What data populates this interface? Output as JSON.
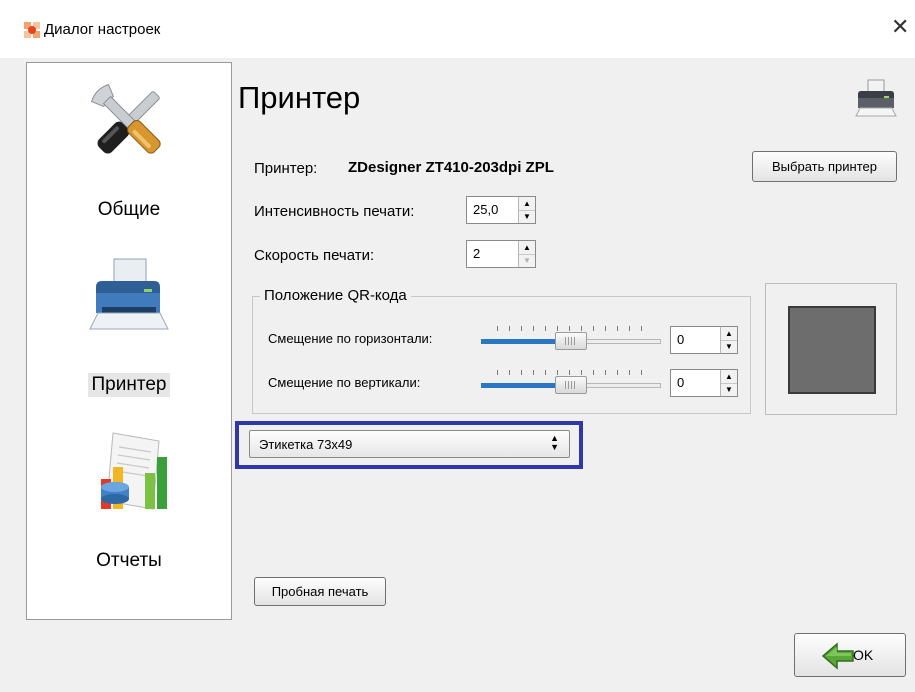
{
  "window": {
    "title": "Диалог настроек",
    "close_glyph": "✕"
  },
  "sidebar": {
    "items": [
      {
        "label": "Общие",
        "icon": "tools-icon"
      },
      {
        "label": "Принтер",
        "icon": "printer-icon",
        "selected": true
      },
      {
        "label": "Отчеты",
        "icon": "reports-chart-icon"
      }
    ]
  },
  "page": {
    "title": "Принтер"
  },
  "printer": {
    "label": "Принтер:",
    "name": "ZDesigner ZT410-203dpi ZPL",
    "select_button": "Выбрать принтер"
  },
  "intensity": {
    "label": "Интенсивность печати:",
    "value": "25,0"
  },
  "speed": {
    "label": "Скорость печати:",
    "value": "2"
  },
  "qr": {
    "group_title": "Положение QR-кода",
    "horizontal": {
      "label": "Смещение по горизонтали:",
      "value": "0",
      "position": 0.5
    },
    "vertical": {
      "label": "Смещение по вертикали:",
      "value": "0",
      "position": 0.5
    }
  },
  "label_select": {
    "value": "Этикетка 73x49",
    "arrows": "▲▼"
  },
  "test_print_button": "Пробная печать",
  "ok_button": "OK",
  "colors": {
    "highlight": "#3037a8",
    "slider_fill": "#2a76c4",
    "preview_fill": "#6d6d6d"
  }
}
